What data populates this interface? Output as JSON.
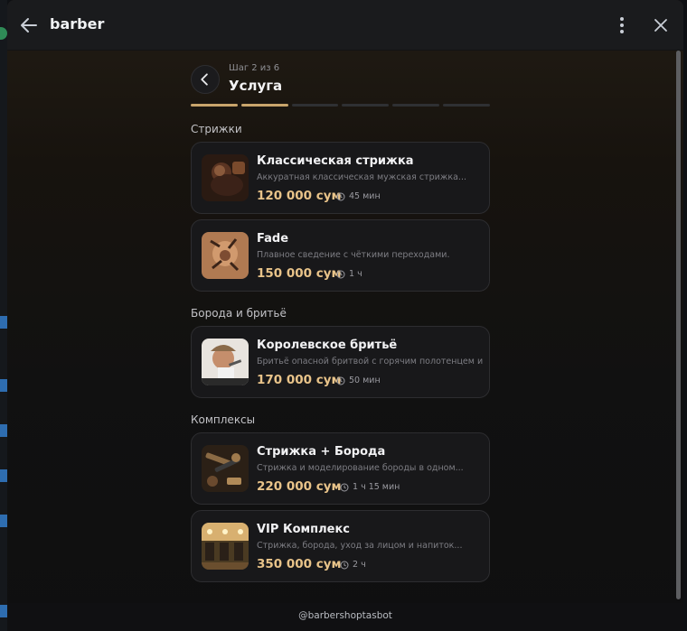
{
  "window": {
    "title": "barber"
  },
  "step": {
    "label": "Шаг 2 из 6",
    "title": "Услуга",
    "current": 2,
    "total": 6
  },
  "sections": [
    {
      "title": "Стрижки",
      "items": [
        {
          "name": "Классическая стрижка",
          "desc": "Аккуратная классическая мужская стрижка...",
          "price": "120 000 сум",
          "time": "45 мин",
          "image": "classic-haircut-photo"
        },
        {
          "name": "Fade",
          "desc": "Плавное сведение с чёткими переходами.",
          "price": "150 000 сум",
          "time": "1 ч",
          "image": "fade-haircut-photo"
        }
      ]
    },
    {
      "title": "Борода и бритьё",
      "items": [
        {
          "name": "Королевское бритьё",
          "desc": "Бритьё опасной бритвой с горячим полотенцем и...",
          "price": "170 000 сум",
          "time": "50 мин",
          "image": "royal-shave-photo"
        }
      ]
    },
    {
      "title": "Комплексы",
      "items": [
        {
          "name": "Стрижка + Борода",
          "desc": "Стрижка и моделирование бороды в одном...",
          "price": "220 000 сум",
          "time": "1 ч 15 мин",
          "image": "haircut-beard-photo"
        },
        {
          "name": "VIP Комплекс",
          "desc": "Стрижка, борода, уход за лицом и напиток...",
          "price": "350 000 сум",
          "time": "2 ч",
          "image": "vip-complex-photo"
        }
      ]
    }
  ],
  "footer": {
    "bot": "@barbershoptasbot"
  },
  "colors": {
    "accent": "#c9a56c",
    "price": "#e8c389",
    "card": "#18181a"
  }
}
